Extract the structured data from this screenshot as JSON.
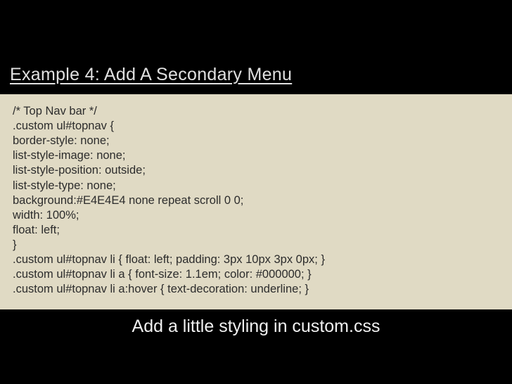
{
  "title": "Example 4:  Add A Secondary Menu",
  "code": {
    "l0": "/* Top Nav bar */",
    "l1": ".custom ul#topnav {",
    "l2": "border-style: none;",
    "l3": "list-style-image: none;",
    "l4": "list-style-position: outside;",
    "l5": "list-style-type: none;",
    "l6": "background:#E4E4E4 none repeat scroll 0 0;",
    "l7": "width: 100%;",
    "l8": "float: left;",
    "l9": "}",
    "l10": ".custom ul#topnav li { float: left; padding: 3px 10px 3px 0px; }",
    "l11": ".custom ul#topnav li a { font-size: 1.1em; color: #000000; }",
    "l12": ".custom ul#topnav li a:hover { text-decoration: underline; }"
  },
  "caption": "Add a little styling in custom.css"
}
